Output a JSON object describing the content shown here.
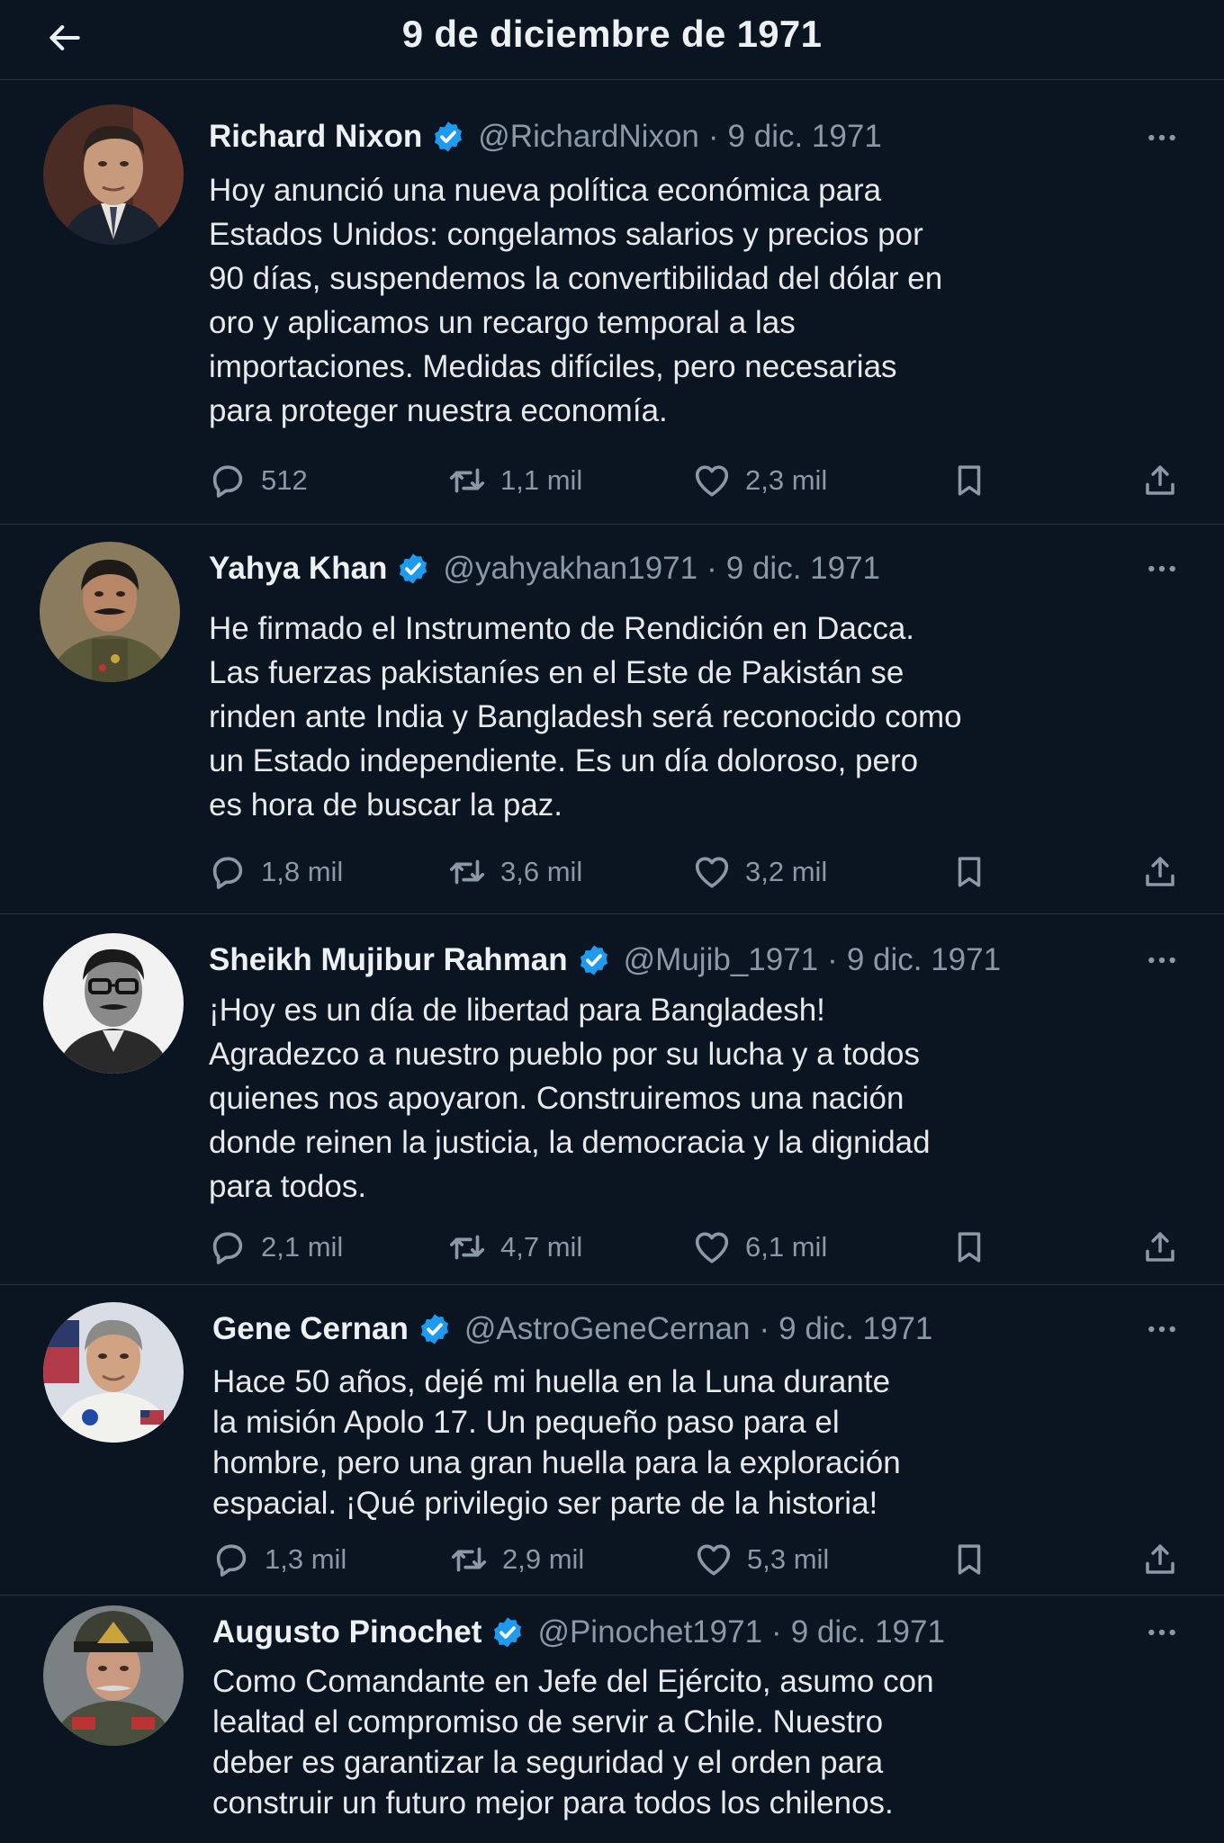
{
  "header": {
    "title": "9 de diciembre de 1971",
    "back_icon": "arrow-left-icon"
  },
  "colors": {
    "background": "#0b1421",
    "verified": "#1d9bf0",
    "secondary_text": "#8b98a5"
  },
  "tweets": [
    {
      "name": "Richard Nixon",
      "handle": "@RichardNixon",
      "date": "9 dic. 1971",
      "text": "Hoy anunció una nueva política económica para\nEstados Unidos: congelamos salarios y precios por\n90 días, suspendemos la convertibilidad del dólar en\noro y aplicamos un recargo temporal a las\nimportaciones. Medidas difíciles, pero necesarias\npara proteger nuestra economía.",
      "replies": "512",
      "retweets": "1,1 mil",
      "likes": "2,3 mil"
    },
    {
      "name": "Yahya Khan",
      "handle": "@yahyakhan1971",
      "date": "9 dic. 1971",
      "text": "He firmado el Instrumento de Rendición en Dacca.\nLas fuerzas pakistaníes en el Este de Pakistán se\nrinden ante India y Bangladesh será reconocido como\nun Estado independiente. Es un día doloroso, pero\nes hora de buscar la paz.",
      "replies": "1,8 mil",
      "retweets": "3,6 mil",
      "likes": "3,2 mil"
    },
    {
      "name": "Sheikh Mujibur Rahman",
      "handle": "@Mujib_1971",
      "date": "9 dic. 1971",
      "text": "¡Hoy es un día de libertad para Bangladesh!\nAgradezco a nuestro pueblo por su lucha y a todos\nquienes nos apoyaron. Construiremos una nación\ndonde reinen la justicia, la democracia y la dignidad\npara todos.",
      "replies": "2,1 mil",
      "retweets": "4,7 mil",
      "likes": "6,1 mil"
    },
    {
      "name": "Gene Cernan",
      "handle": "@AstroGeneCernan",
      "date": "9 dic. 1971",
      "text": "Hace 50 años, dejé mi huella en la Luna durante\nla misión Apolo 17. Un pequeño paso para el\nhombre, pero una gran huella para la exploración\nespacial. ¡Qué privilegio ser parte de la historia!",
      "replies": "1,3 mil",
      "retweets": "2,9 mil",
      "likes": "5,3 mil"
    },
    {
      "name": "Augusto Pinochet",
      "handle": "@Pinochet1971",
      "date": "9 dic. 1971",
      "text": "Como Comandante en Jefe del Ejército, asumo con\nlealtad el compromiso de servir a Chile. Nuestro\ndeber es garantizar la seguridad y el orden para\nconstruir un futuro mejor para todos los chilenos."
    }
  ]
}
